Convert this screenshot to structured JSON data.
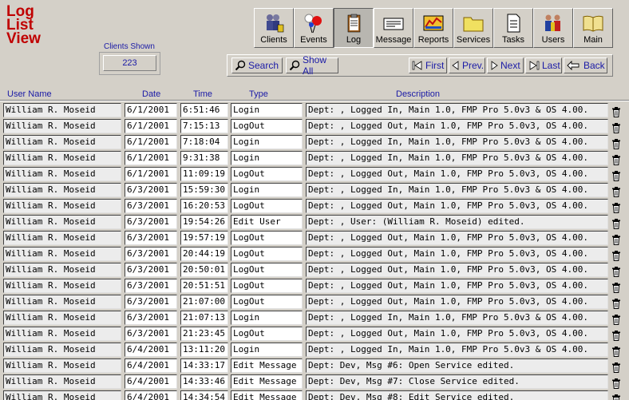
{
  "title": {
    "line1": "Log",
    "line2": "List",
    "line3": "View"
  },
  "clients": {
    "label": "Clients Shown",
    "value": "223"
  },
  "toolbar": [
    {
      "label": "Clients",
      "icon": "clients-icon"
    },
    {
      "label": "Events",
      "icon": "events-icon"
    },
    {
      "label": "Log",
      "icon": "log-icon"
    },
    {
      "label": "Message",
      "icon": "message-icon"
    },
    {
      "label": "Reports",
      "icon": "reports-icon"
    },
    {
      "label": "Services",
      "icon": "services-icon"
    },
    {
      "label": "Tasks",
      "icon": "tasks-icon"
    },
    {
      "label": "Users",
      "icon": "users-icon"
    },
    {
      "label": "Main",
      "icon": "main-icon"
    }
  ],
  "active_tab": "Log",
  "nav": {
    "search": "Search",
    "show_all": "Show All",
    "first": "First",
    "prev": "Prev.",
    "next": "Next",
    "last": "Last",
    "back": "Back"
  },
  "columns": {
    "user_name": "User Name",
    "date": "Date",
    "time": "Time",
    "type": "Type",
    "description": "Description"
  },
  "rows": [
    {
      "user": "William R. Moseid",
      "date": "6/1/2001",
      "time": "6:51:46",
      "type": "Login",
      "desc": "Dept: ,  Logged In, Main 1.0, FMP Pro 5.0v3 & OS 4.00."
    },
    {
      "user": "William R. Moseid",
      "date": "6/1/2001",
      "time": "7:15:13",
      "type": "LogOut",
      "desc": "Dept: ,  Logged Out, Main 1.0, FMP Pro 5.0v3, OS 4.00."
    },
    {
      "user": "William R. Moseid",
      "date": "6/1/2001",
      "time": "7:18:04",
      "type": "Login",
      "desc": "Dept: ,  Logged In, Main 1.0, FMP Pro 5.0v3 & OS 4.00."
    },
    {
      "user": "William R. Moseid",
      "date": "6/1/2001",
      "time": "9:31:38",
      "type": "Login",
      "desc": "Dept: ,  Logged In, Main 1.0, FMP Pro 5.0v3 & OS 4.00."
    },
    {
      "user": "William R. Moseid",
      "date": "6/1/2001",
      "time": "11:09:19",
      "type": "LogOut",
      "desc": "Dept: ,  Logged Out, Main 1.0, FMP Pro 5.0v3, OS 4.00."
    },
    {
      "user": "William R. Moseid",
      "date": "6/3/2001",
      "time": "15:59:30",
      "type": "Login",
      "desc": "Dept: ,  Logged In, Main 1.0, FMP Pro 5.0v3 & OS 4.00."
    },
    {
      "user": "William R. Moseid",
      "date": "6/3/2001",
      "time": "16:20:53",
      "type": "LogOut",
      "desc": "Dept: ,  Logged Out, Main 1.0, FMP Pro 5.0v3, OS 4.00."
    },
    {
      "user": "William R. Moseid",
      "date": "6/3/2001",
      "time": "19:54:26",
      "type": "Edit User",
      "desc": "Dept: , User: (William R. Moseid) edited."
    },
    {
      "user": "William R. Moseid",
      "date": "6/3/2001",
      "time": "19:57:19",
      "type": "LogOut",
      "desc": "Dept: ,  Logged Out, Main 1.0, FMP Pro 5.0v3, OS 4.00."
    },
    {
      "user": "William R. Moseid",
      "date": "6/3/2001",
      "time": "20:44:19",
      "type": "LogOut",
      "desc": "Dept: ,  Logged Out, Main 1.0, FMP Pro 5.0v3, OS 4.00."
    },
    {
      "user": "William R. Moseid",
      "date": "6/3/2001",
      "time": "20:50:01",
      "type": "LogOut",
      "desc": "Dept: ,  Logged Out, Main 1.0, FMP Pro 5.0v3, OS 4.00."
    },
    {
      "user": "William R. Moseid",
      "date": "6/3/2001",
      "time": "20:51:51",
      "type": "LogOut",
      "desc": "Dept: ,  Logged Out, Main 1.0, FMP Pro 5.0v3, OS 4.00."
    },
    {
      "user": "William R. Moseid",
      "date": "6/3/2001",
      "time": "21:07:00",
      "type": "LogOut",
      "desc": "Dept: ,  Logged Out, Main 1.0, FMP Pro 5.0v3, OS 4.00."
    },
    {
      "user": "William R. Moseid",
      "date": "6/3/2001",
      "time": "21:07:13",
      "type": "Login",
      "desc": "Dept: ,  Logged In, Main 1.0, FMP Pro 5.0v3 & OS 4.00."
    },
    {
      "user": "William R. Moseid",
      "date": "6/3/2001",
      "time": "21:23:45",
      "type": "LogOut",
      "desc": "Dept: ,  Logged Out, Main 1.0, FMP Pro 5.0v3, OS 4.00."
    },
    {
      "user": "William R. Moseid",
      "date": "6/4/2001",
      "time": "13:11:20",
      "type": "Login",
      "desc": "Dept: ,  Logged In, Main 1.0, FMP Pro 5.0v3 & OS 4.00."
    },
    {
      "user": "William R. Moseid",
      "date": "6/4/2001",
      "time": "14:33:17",
      "type": "Edit Message",
      "desc": "Dept:  Dev, Msg #6: Open Service edited."
    },
    {
      "user": "William R. Moseid",
      "date": "6/4/2001",
      "time": "14:33:46",
      "type": "Edit Message",
      "desc": "Dept:  Dev, Msg #7: Close Service edited."
    },
    {
      "user": "William R. Moseid",
      "date": "6/4/2001",
      "time": "14:34:54",
      "type": "Edit Message",
      "desc": "Dept:  Dev, Msg #8: Edit Service edited."
    }
  ],
  "colors": {
    "title": "#c00000",
    "label": "#1a1aa6",
    "background": "#d4d0c8"
  }
}
